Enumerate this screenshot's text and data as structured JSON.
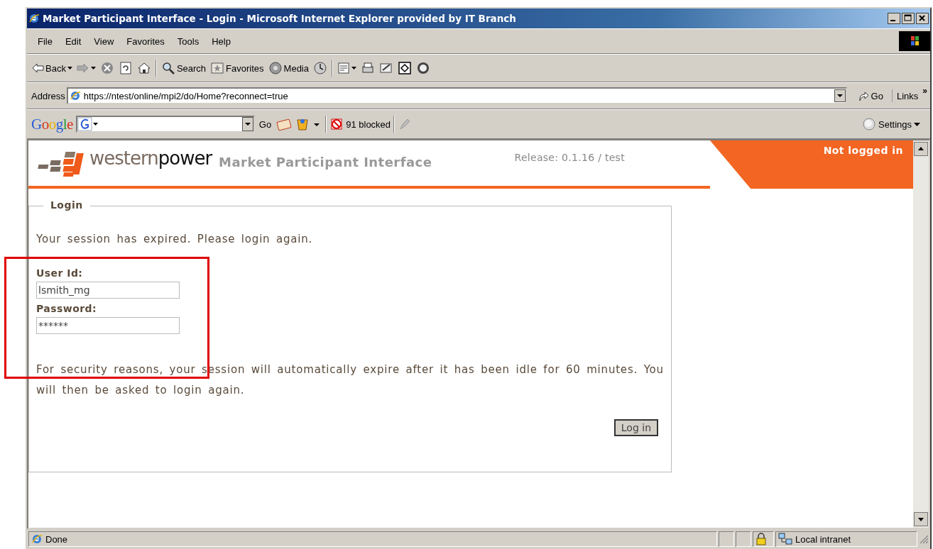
{
  "window": {
    "title": "Market Participant Interface - Login - Microsoft Internet Explorer provided by IT Branch"
  },
  "menu": [
    "File",
    "Edit",
    "View",
    "Favorites",
    "Tools",
    "Help"
  ],
  "toolbar": {
    "back": "Back",
    "search": "Search",
    "favorites": "Favorites",
    "media": "Media"
  },
  "address_bar": {
    "label": "Address",
    "url": "https://ntest/online/mpi2/do/Home?reconnect=true",
    "go": "Go",
    "links": "Links",
    "more": "»"
  },
  "google_bar": {
    "logo": "Google",
    "go": "Go",
    "blocked": "91 blocked",
    "settings": "Settings"
  },
  "page": {
    "brand_light": "western",
    "brand_dark": "power",
    "app_title": "Market Participant Interface",
    "release": "Release: 0.1.16 / test",
    "login_status": "Not logged in",
    "form": {
      "legend": "Login",
      "message": "Your session has expired. Please login again.",
      "fields": [
        {
          "label": "User Id:",
          "value": "lsmith_mg"
        },
        {
          "label": "Password:",
          "value": "******"
        }
      ],
      "note": "For security reasons, your session will automatically expire after it has been idle for 60 minutes. You will then be asked to login again.",
      "button": "Log in"
    }
  },
  "status_bar": {
    "text": "Done",
    "zone": "Local intranet"
  },
  "annotations": [
    {
      "kind": "rectangle"
    }
  ]
}
